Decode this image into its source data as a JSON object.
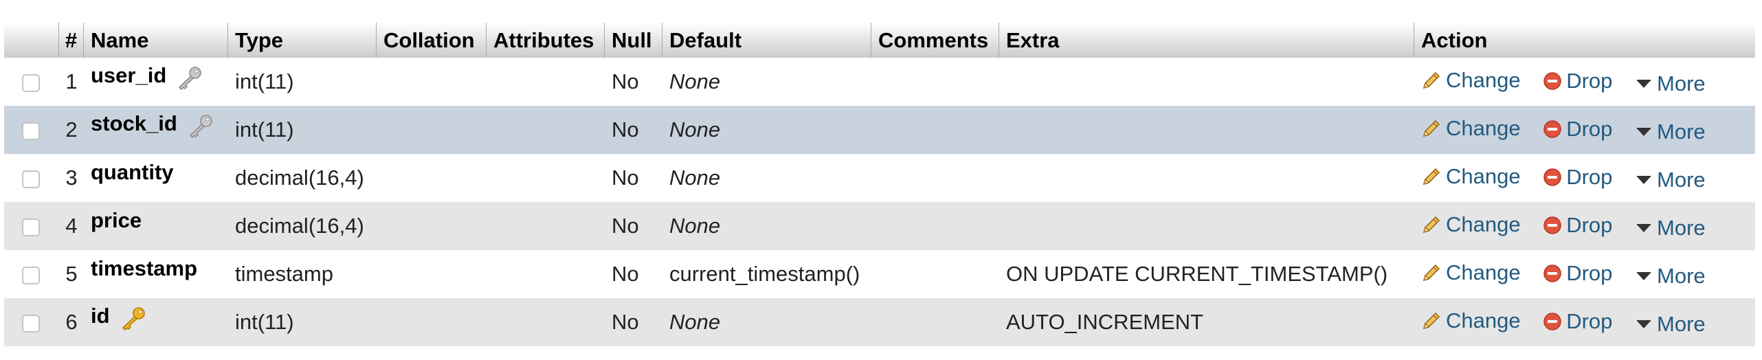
{
  "table": {
    "headers": {
      "num": "#",
      "name": "Name",
      "type": "Type",
      "collation": "Collation",
      "attributes": "Attributes",
      "null": "Null",
      "default": "Default",
      "comments": "Comments",
      "extra": "Extra",
      "action": "Action"
    },
    "rows": [
      {
        "num": "1",
        "name": "user_id",
        "key": "index",
        "type": "int(11)",
        "collation": "",
        "attributes": "",
        "null": "No",
        "default": "None",
        "default_italic": true,
        "comments": "",
        "extra": "",
        "highlighted": false
      },
      {
        "num": "2",
        "name": "stock_id",
        "key": "index",
        "type": "int(11)",
        "collation": "",
        "attributes": "",
        "null": "No",
        "default": "None",
        "default_italic": true,
        "comments": "",
        "extra": "",
        "highlighted": true
      },
      {
        "num": "3",
        "name": "quantity",
        "key": "none",
        "type": "decimal(16,4)",
        "collation": "",
        "attributes": "",
        "null": "No",
        "default": "None",
        "default_italic": true,
        "comments": "",
        "extra": "",
        "highlighted": false
      },
      {
        "num": "4",
        "name": "price",
        "key": "none",
        "type": "decimal(16,4)",
        "collation": "",
        "attributes": "",
        "null": "No",
        "default": "None",
        "default_italic": true,
        "comments": "",
        "extra": "",
        "highlighted": false
      },
      {
        "num": "5",
        "name": "timestamp",
        "key": "none",
        "type": "timestamp",
        "collation": "",
        "attributes": "",
        "null": "No",
        "default": "current_timestamp()",
        "default_italic": false,
        "comments": "",
        "extra": "ON UPDATE CURRENT_TIMESTAMP()",
        "highlighted": false
      },
      {
        "num": "6",
        "name": "id",
        "key": "primary",
        "type": "int(11)",
        "collation": "",
        "attributes": "",
        "null": "No",
        "default": "None",
        "default_italic": true,
        "comments": "",
        "extra": "AUTO_INCREMENT",
        "highlighted": false
      }
    ],
    "actions": {
      "change": "Change",
      "drop": "Drop",
      "more": "More"
    }
  },
  "icons": {
    "index_key": "grey-key-icon",
    "primary_key": "gold-key-icon",
    "change": "pencil-icon",
    "drop": "drop-icon",
    "more": "triangle-down-icon"
  },
  "colors": {
    "link": "#235a81",
    "row_even": "#e5e5e5",
    "row_highlight": "#c8d3de",
    "drop_red": "#e0533e",
    "primary_key_gold": "#f0b429"
  }
}
